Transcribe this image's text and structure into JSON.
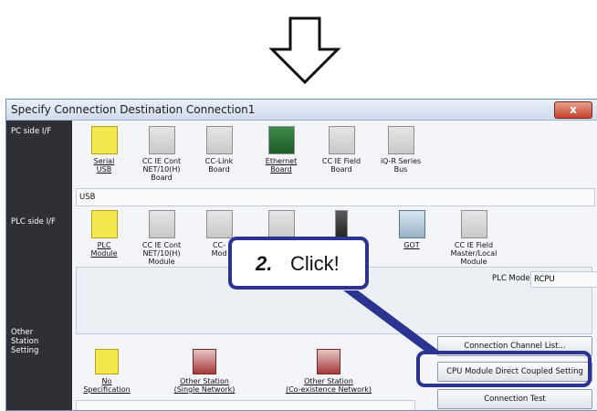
{
  "window": {
    "title": "Specify Connection Destination Connection1",
    "close_label": "x"
  },
  "side_labels": {
    "pc_side": "PC side I/F",
    "plc_side": "PLC side I/F",
    "other_station": "Other\nStation\nSetting"
  },
  "pc_side_items": [
    {
      "label": "Serial\nUSB",
      "icon": "serial-usb-icon"
    },
    {
      "label": "CC IE Cont\nNET/10(H)\nBoard",
      "icon": "board-icon"
    },
    {
      "label": "CC-Link\nBoard",
      "icon": "board-icon"
    },
    {
      "label": "Ethernet\nBoard",
      "icon": "ethernet-board-icon"
    },
    {
      "label": "CC IE Field\nBoard",
      "icon": "board-icon"
    },
    {
      "label": "iQ-R Series\nBus",
      "icon": "bus-icon"
    }
  ],
  "pc_side_field": "USB",
  "plc_side_items": [
    {
      "label": "PLC\nModule",
      "icon": "plc-module-icon"
    },
    {
      "label": "CC IE Cont\nNET/10(H)\nModule",
      "icon": "module-icon"
    },
    {
      "label": "CC-\nMod",
      "icon": "module-icon"
    },
    {
      "label": "GOT",
      "icon": "got-icon"
    },
    {
      "label": "CC IE Field\nMaster/Local\nModule",
      "icon": "module-icon"
    }
  ],
  "plc_mode": {
    "label": "PLC Mode",
    "value": "RCPU"
  },
  "other_station_items": [
    {
      "label": "No Specification"
    },
    {
      "label": "Other Station\n(Single Network)"
    },
    {
      "label": "Other Station\n(Co-existence Network)"
    }
  ],
  "buttons": {
    "channel_list": "Connection Channel List...",
    "direct_coupled": "CPU Module Direct Coupled Setting",
    "connection_test": "Connection Test"
  },
  "callout": {
    "number": "2.",
    "text": "Click!"
  },
  "colors": {
    "highlight": "#2b3591",
    "selected_icon": "#f4e84e"
  }
}
